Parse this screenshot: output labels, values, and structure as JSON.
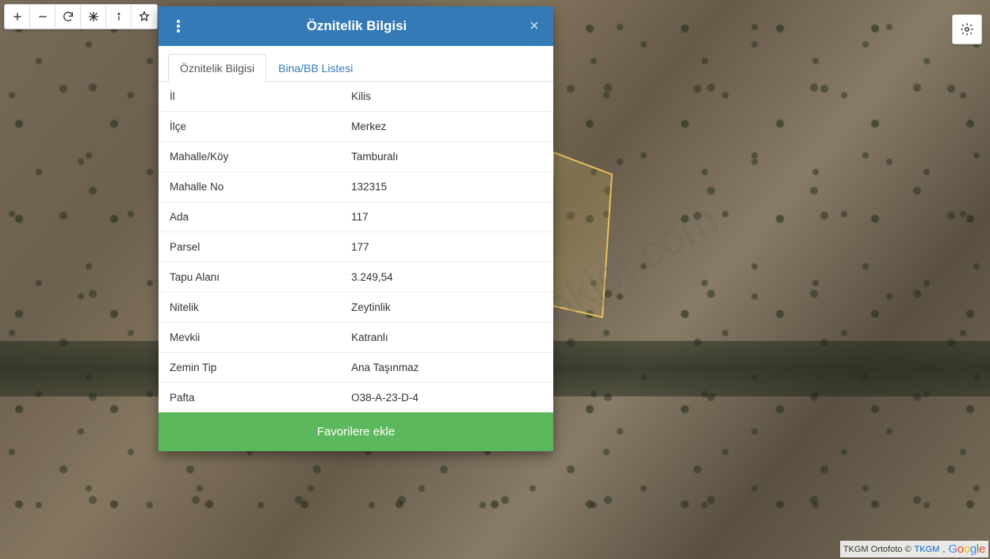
{
  "toolbar": {
    "zoom_in": "+",
    "zoom_out": "−",
    "refresh": "refresh",
    "extent": "extent",
    "info": "i",
    "star": "star"
  },
  "settings": "settings",
  "panel": {
    "title": "Öznitelik Bilgisi",
    "tabs": [
      {
        "label": "Öznitelik Bilgisi",
        "active": true
      },
      {
        "label": "Bina/BB Listesi",
        "active": false
      }
    ],
    "rows": [
      {
        "key": "İl",
        "value": "Kilis"
      },
      {
        "key": "İlçe",
        "value": "Merkez"
      },
      {
        "key": "Mahalle/Köy",
        "value": "Tamburalı"
      },
      {
        "key": "Mahalle No",
        "value": "132315"
      },
      {
        "key": "Ada",
        "value": "117"
      },
      {
        "key": "Parsel",
        "value": "177"
      },
      {
        "key": "Tapu Alanı",
        "value": "3.249,54"
      },
      {
        "key": "Nitelik",
        "value": "Zeytinlik"
      },
      {
        "key": "Mevkii",
        "value": "Katranlı"
      },
      {
        "key": "Zemin Tip",
        "value": "Ana Taşınmaz"
      },
      {
        "key": "Pafta",
        "value": "O38-A-23-D-4"
      }
    ],
    "favorite_label": "Favorilere ekle"
  },
  "watermark": "emlakjet.com",
  "attribution": {
    "prefix": "TKGM Ortofoto © ",
    "link": "TKGM",
    "suffix": ","
  }
}
